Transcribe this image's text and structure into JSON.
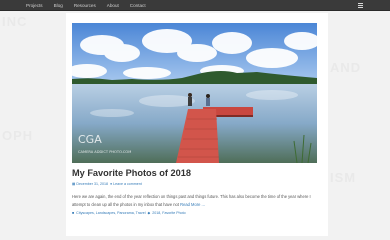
{
  "nav": {
    "items": [
      "Projects",
      "Blog",
      "Resources",
      "About",
      "Contact"
    ],
    "toggle_icon": "menu-icon"
  },
  "post": {
    "title": "My Favorite Photos of 2018",
    "date": "December 31, 2018",
    "comment_link": "Leave a comment",
    "excerpt": "Here we are again, the end of the year reflection on things past and things future. This has also become the time of the year where I attempt to clean up all the photos in my inbox that have not",
    "read_more": "Read More ...",
    "categories": "Cityscapes, Landscapes, Panorama, Travel",
    "tags": "2018, Favorite Photo",
    "watermark": "CAMERA ADDICT PHOTO.COM",
    "watermark_logo": "CGA"
  },
  "colors": {
    "nav_bg": "#3a3a3a",
    "link": "#337ab7",
    "page_bg": "#f2f2f2",
    "card_bg": "#ffffff"
  }
}
